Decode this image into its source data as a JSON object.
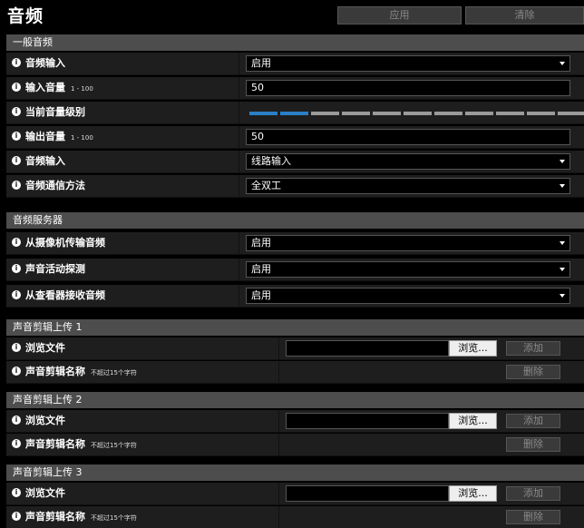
{
  "header": {
    "title": "音频",
    "apply_label": "应用",
    "clear_label": "清除"
  },
  "general": {
    "title": "一般音频",
    "audio_input": {
      "label": "音频输入",
      "value": "启用"
    },
    "input_volume": {
      "label": "输入音量",
      "hint": "1 - 100",
      "value": "50"
    },
    "current_level": {
      "label": "当前音量级别",
      "active_segments": 2,
      "total_segments": 11
    },
    "output_volume": {
      "label": "输出音量",
      "hint": "1 - 100",
      "value": "50"
    },
    "audio_input_source": {
      "label": "音频输入",
      "value": "线路输入"
    },
    "comm_method": {
      "label": "音频通信方法",
      "value": "全双工"
    }
  },
  "server": {
    "title": "音频服务器",
    "transmit": {
      "label": "从摄像机传输音频",
      "value": "启用"
    },
    "detection": {
      "label": "声音活动探测",
      "value": "启用"
    },
    "receive": {
      "label": "从查看器接收音频",
      "value": "启用"
    }
  },
  "clips": [
    {
      "title": "声音剪辑上传 1",
      "browse_label": "浏览文件",
      "browse_btn": "浏览...",
      "add_btn": "添加",
      "name_label": "声音剪辑名称",
      "name_hint": "不超过15个字符",
      "delete_btn": "删除"
    },
    {
      "title": "声音剪辑上传 2",
      "browse_label": "浏览文件",
      "browse_btn": "浏览...",
      "add_btn": "添加",
      "name_label": "声音剪辑名称",
      "name_hint": "不超过15个字符",
      "delete_btn": "删除"
    },
    {
      "title": "声音剪辑上传 3",
      "browse_label": "浏览文件",
      "browse_btn": "浏览...",
      "add_btn": "添加",
      "name_label": "声音剪辑名称",
      "name_hint": "不超过15个字符",
      "delete_btn": "删除"
    }
  ],
  "info_glyph": "i"
}
